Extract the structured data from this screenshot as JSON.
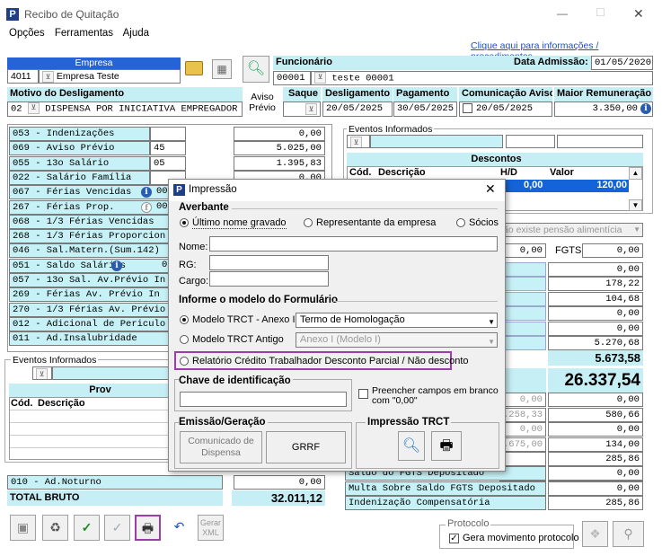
{
  "window": {
    "title": "Recibo de Quitação",
    "minimize": "—",
    "maximize": "☐",
    "close": "✕"
  },
  "menu": [
    "Opções",
    "Ferramentas",
    "Ajuda"
  ],
  "help_link": "Clique aqui para informações / procedimentos",
  "empresa": {
    "label": "Empresa",
    "code": "4011",
    "name": "Empresa Teste"
  },
  "funcionario": {
    "label": "Funcionário",
    "code": "00001",
    "name": "teste 00001",
    "admissao_label": "Data Admissão:",
    "admissao": "01/05/2020"
  },
  "motivo": {
    "label": "Motivo do Desligamento",
    "code": "02",
    "text": "DISPENSA POR INICIATIVA EMPREGADOR",
    "aviso_label_1": "Aviso",
    "aviso_label_2": "Prévio",
    "saque_label": "Saque"
  },
  "datas": {
    "desligamento_label": "Desligamento",
    "desligamento": "20/05/2025",
    "pagamento_label": "Pagamento",
    "pagamento": "30/05/2025",
    "comunicacao_label": "Comunicação Aviso",
    "comunicacao": "20/05/2025",
    "maior_label": "Maior Remuneração",
    "maior": "3.350,00"
  },
  "proventos": [
    {
      "desc": "053 - Indenizações",
      "ref": "",
      "val": "0,00"
    },
    {
      "desc": "069 - Aviso Prévio",
      "ref": "45",
      "val": "5.025,00"
    },
    {
      "desc": "055 - 13o Salário",
      "ref": "05",
      "val": "1.395,83",
      "info": true
    },
    {
      "desc": "022 - Salário Família",
      "ref": "",
      "val": "0,00"
    },
    {
      "desc": "067 - Férias Vencidas",
      "ref": "00",
      "val": "",
      "info": true
    },
    {
      "desc": "267 - Férias Prop.",
      "ref": "00",
      "val": "",
      "info2": true
    },
    {
      "desc": "068 - 1/3 Férias Vencidas",
      "ref": "",
      "val": ""
    },
    {
      "desc": "268 - 1/3 Férias Proporcion",
      "ref": "",
      "val": ""
    },
    {
      "desc": "046 - Sal.Matern.(Sum.142)",
      "ref": "",
      "val": ""
    },
    {
      "desc": "051 - Saldo Salários",
      "ref": "0",
      "val": "",
      "info": true
    },
    {
      "desc": "057 - 13o Sal. Av.Prévio In",
      "ref": "",
      "val": ""
    },
    {
      "desc": "269 - Férias  Av. Prévio In",
      "ref": "",
      "val": ""
    },
    {
      "desc": "270 - 1/3 Férias Av. Prévio",
      "ref": "",
      "val": ""
    },
    {
      "desc": "012 - Adicional de Periculo",
      "ref": "",
      "val": ""
    },
    {
      "desc": "011 - Ad.Insalubridade",
      "ref": "",
      "val": ""
    }
  ],
  "eventos_left": {
    "label": "Eventos Informados",
    "col_title": "Prov",
    "cod": "Cód.",
    "desc": "Descrição"
  },
  "adnoturno": {
    "desc": "010 - Ad.Noturno",
    "val": "0,00"
  },
  "total_bruto": {
    "label": "TOTAL BRUTO",
    "val": "32.011,12"
  },
  "eventos_right": {
    "label": "Eventos Informados",
    "descontos": "Descontos",
    "cod": "Cód.",
    "desc": "Descrição",
    "hd": "H/D",
    "valor": "Valor",
    "row_hd": "0,00",
    "row_val": "120,00"
  },
  "pensao": "ão existe pensão alimentícia",
  "fgts": {
    "left_val": "0,00",
    "label": "FGTS",
    "val": "0,00"
  },
  "descontos_vals": [
    "0,00",
    "178,22",
    "104,68",
    "0,00",
    "0,00",
    "5.270,68"
  ],
  "total_desc": "5.673,58",
  "liquido": "26.337,54",
  "right_vals": [
    {
      "a": "0,00",
      "b": "0,00"
    },
    {
      "a": ".258,33",
      "b": "580,66"
    },
    {
      "a": "0,00",
      "b": "0,00"
    },
    {
      "a": ".675,00",
      "b": "134,00"
    },
    {
      "a": "",
      "b": "285,86"
    },
    {
      "a": "",
      "b": ""
    }
  ],
  "multa_rows": [
    {
      "desc": "Saldo do FGTS Depositado",
      "val": "0,00"
    },
    {
      "desc": "Multa Sobre Saldo FGTS Depositado",
      "val": "0,00"
    },
    {
      "desc": "Indenização Compensatória",
      "val": "285,86"
    }
  ],
  "protocolo": {
    "label": "Protocolo",
    "check": "Gera movimento protocolo"
  },
  "toolbar": {
    "gerar_xml": "Gerar XML"
  },
  "dialog": {
    "title": "Impressão",
    "averbante": "Averbante",
    "radio1": "Último nome gravado",
    "radio2": "Representante da empresa",
    "radio3": "Sócios",
    "nome": "Nome:",
    "rg": "RG:",
    "cargo": "Cargo:",
    "modelo_title": "Informe o modelo do Formulário",
    "modelo1": "Modelo TRCT - Anexo I",
    "modelo1_sel": "Termo de Homologação",
    "modelo2": "Modelo TRCT Antigo",
    "modelo2_sel": "Anexo I (Modelo I)",
    "relatorio": "Relatório Crédito Trabalhador Desconto Parcial / Não desconto",
    "chave": "Chave de identificação",
    "preencher": "Preencher campos em branco com \"0,00\"",
    "emissao": "Emissão/Geração",
    "comunicado": "Comunicado de Dispensa",
    "grrf": "GRRF",
    "impressao_trct": "Impressão TRCT"
  }
}
